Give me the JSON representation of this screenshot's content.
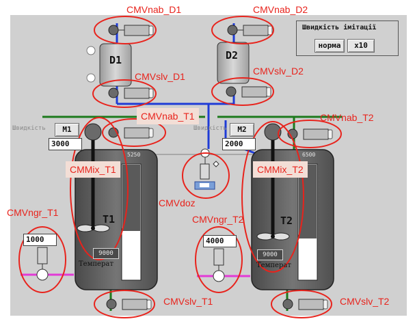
{
  "callouts": {
    "nab_d1": "CMVnab_D1",
    "nab_d2": "CMVnab_D2",
    "slv_d1": "CMVslv_D1",
    "slv_d2": "CMVslv_D2",
    "nab_t1": "CMVnab_T1",
    "nab_t2": "CMVnab_T2",
    "mix_t1": "CMMix_T1",
    "mix_t2": "CMMix_T2",
    "doz": "CMVdoz",
    "ngr_t1": "CMVngr_T1",
    "ngr_t2": "CMVngr_T2",
    "slv_t1": "CMVslv_T1",
    "slv_t2": "CMVslv_T2"
  },
  "speed_panel": {
    "title": "Швидкість імітації",
    "normal_label": "норма",
    "x10_label": "x10"
  },
  "dosers": {
    "d1": "D1",
    "d2": "D2"
  },
  "tank1": {
    "id": "T1",
    "speed_label": "Швидкість",
    "motor_label": "M1",
    "motor_speed": "3000",
    "level_value": "5250",
    "heater_value": "1000",
    "temp_value": "9000",
    "temp_label": "Температ",
    "fill_level": 0.42
  },
  "tank2": {
    "id": "T2",
    "speed_label": "Швидкість",
    "motor_label": "M2",
    "motor_speed": "2000",
    "level_value": "6500",
    "heater_value": "4000",
    "temp_value": "9000",
    "temp_label": "Температ",
    "fill_level": 0.36
  },
  "colors": {
    "panel_bg": "#d0d0d0",
    "tank_body": "#5a5a5a",
    "pipe_blue": "#1f3cd6",
    "pipe_green": "#1d7a1d",
    "pipe_magenta": "#e23ad6",
    "callout_red": "#e8231c"
  }
}
